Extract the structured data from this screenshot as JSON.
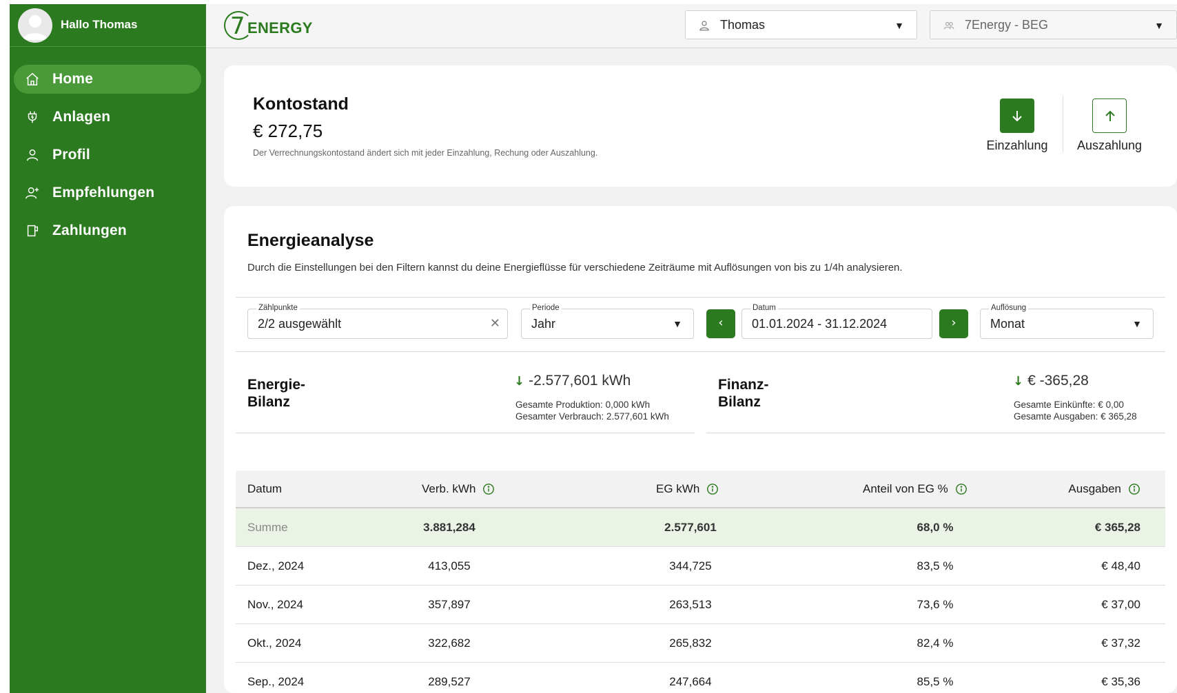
{
  "sidebar": {
    "greeting": "Hallo Thomas",
    "items": [
      {
        "label": "Home",
        "icon": "home-icon",
        "active": true
      },
      {
        "label": "Anlagen",
        "icon": "plug-icon",
        "active": false
      },
      {
        "label": "Profil",
        "icon": "user-icon",
        "active": false
      },
      {
        "label": "Empfehlungen",
        "icon": "user-plus-icon",
        "active": false
      },
      {
        "label": "Zahlungen",
        "icon": "document-icon",
        "active": false
      }
    ]
  },
  "header": {
    "logo_seven": "7",
    "logo_text": "ENERGY",
    "user_select": "Thomas",
    "org_select": "7Energy - BEG"
  },
  "konto": {
    "title": "Kontostand",
    "value": "€ 272,75",
    "note": "Der Verrechnungskontostand ändert sich mit jeder Einzahlung, Rechung oder Auszahlung.",
    "deposit_label": "Einzahlung",
    "withdraw_label": "Auszahlung"
  },
  "energie": {
    "title": "Energieanalyse",
    "description": "Durch die Einstellungen bei den Filtern kannst du deine Energieflüsse für verschiedene Zeiträume mit Auflösungen von bis zu 1/4h analysieren.",
    "filters": {
      "zaehlpunkte_label": "Zählpunkte",
      "zaehlpunkte_value": "2/2 ausgewählt",
      "periode_label": "Periode",
      "periode_value": "Jahr",
      "datum_label": "Datum",
      "datum_value": "01.01.2024 - 31.12.2024",
      "aufloesung_label": "Auflösung",
      "aufloesung_value": "Monat"
    },
    "energie_bilanz": {
      "title_line1": "Energie-",
      "title_line2": "Bilanz",
      "value": "-2.577,601 kWh",
      "sub1": "Gesamte Produktion: 0,000 kWh",
      "sub2": "Gesamter Verbrauch: 2.577,601 kWh"
    },
    "finanz_bilanz": {
      "title_line1": "Finanz-",
      "title_line2": "Bilanz",
      "value": "€ -365,28",
      "sub1": "Gesamte Einkünfte: € 0,00",
      "sub2": "Gesamte Ausgaben: € 365,28"
    }
  },
  "table": {
    "headers": [
      "Datum",
      "Verb. kWh",
      "EG kWh",
      "Anteil von EG %",
      "Ausgaben"
    ],
    "sum": [
      "Summe",
      "3.881,284",
      "2.577,601",
      "68,0 %",
      "€ 365,28"
    ],
    "rows": [
      [
        "Dez., 2024",
        "413,055",
        "344,725",
        "83,5 %",
        "€ 48,40"
      ],
      [
        "Nov., 2024",
        "357,897",
        "263,513",
        "73,6 %",
        "€ 37,00"
      ],
      [
        "Okt., 2024",
        "322,682",
        "265,832",
        "82,4 %",
        "€ 37,32"
      ],
      [
        "Sep., 2024",
        "289,527",
        "247,664",
        "85,5 %",
        "€ 35,36"
      ]
    ]
  },
  "colors": {
    "brand_green": "#2c7a1f",
    "active_nav": "#4a9a39",
    "sum_row": "#eaf3e6"
  }
}
